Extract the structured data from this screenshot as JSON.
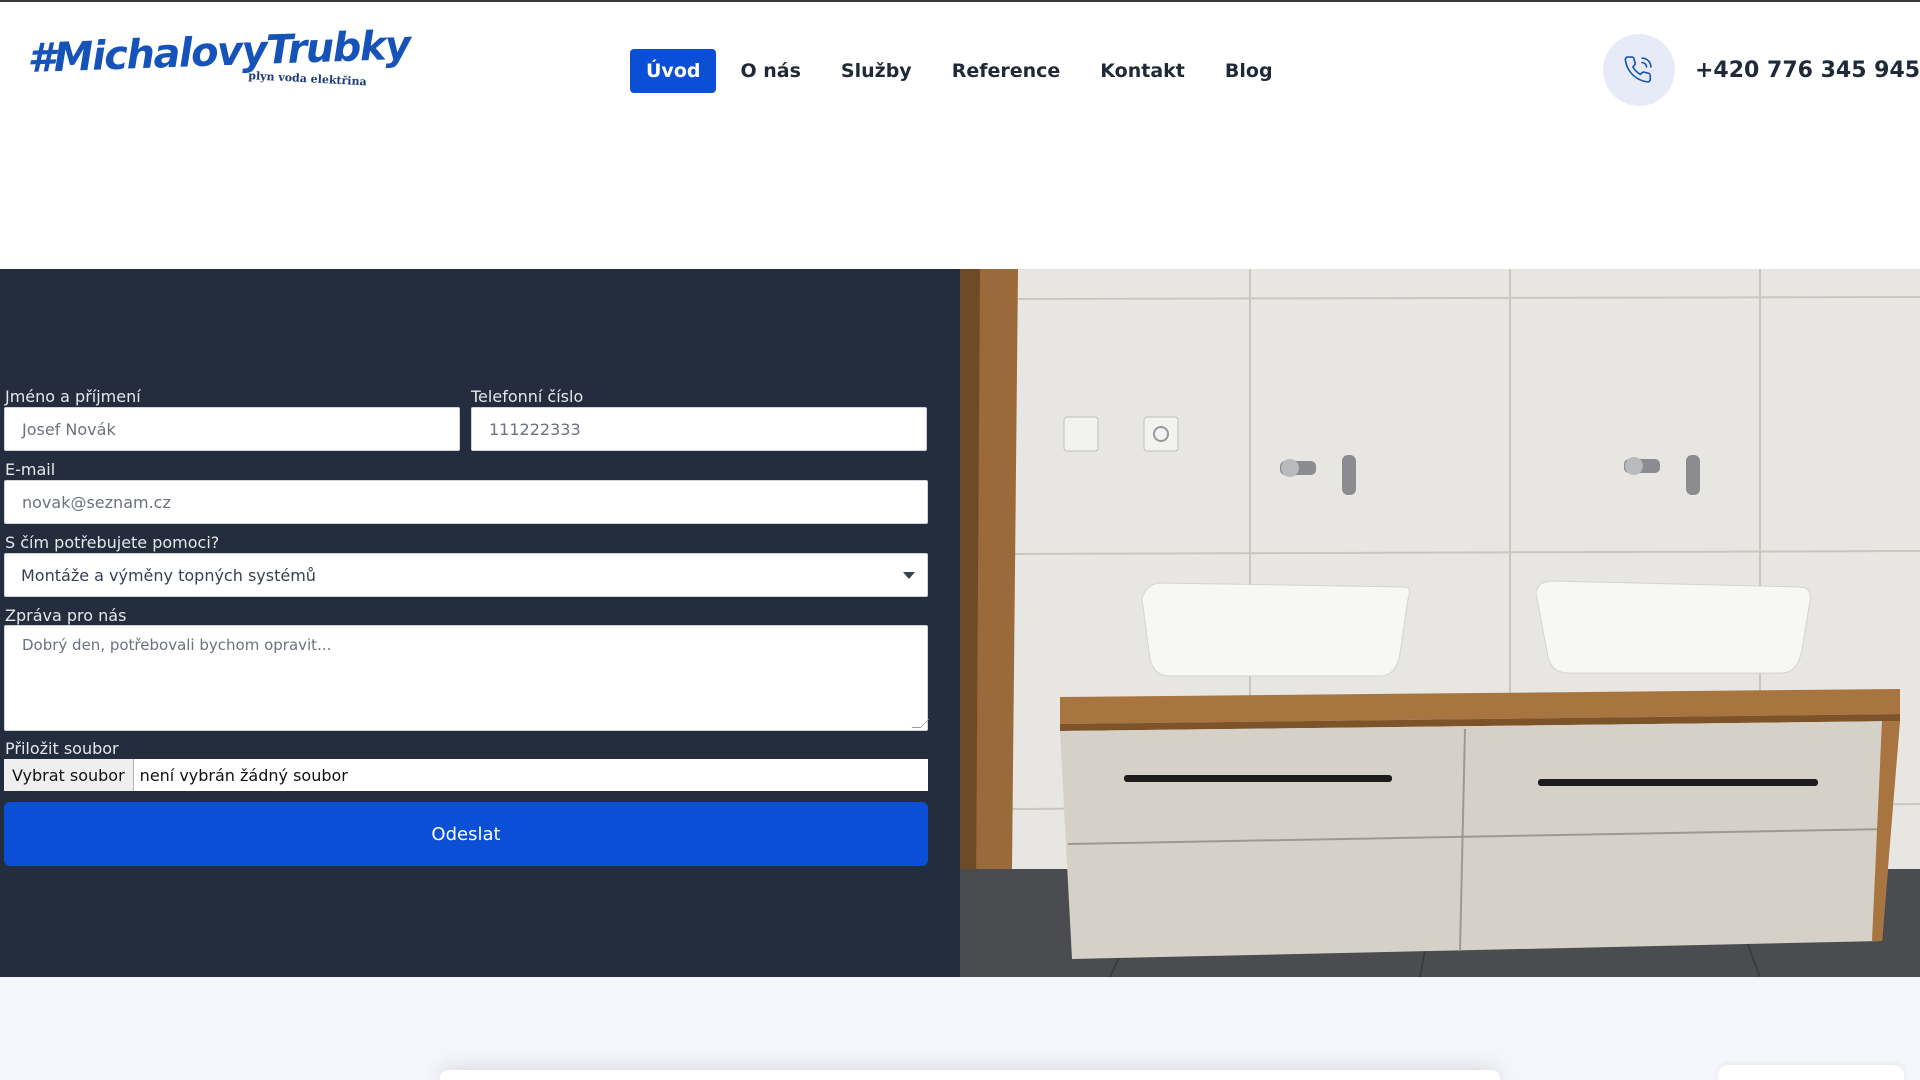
{
  "logo": {
    "text": "#MichalovyTrubky",
    "tagline": "plyn voda elektřina"
  },
  "nav": {
    "items": [
      {
        "label": "Úvod",
        "active": true
      },
      {
        "label": "O nás",
        "active": false
      },
      {
        "label": "Služby",
        "active": false
      },
      {
        "label": "Reference",
        "active": false
      },
      {
        "label": "Kontakt",
        "active": false
      },
      {
        "label": "Blog",
        "active": false
      }
    ]
  },
  "contact": {
    "phone": "+420 776 345 945",
    "icon": "phone-icon"
  },
  "form": {
    "name": {
      "label": "Jméno a příjmení",
      "placeholder": "Josef Novák"
    },
    "phone": {
      "label": "Telefonní číslo",
      "placeholder": "111222333"
    },
    "email": {
      "label": "E-mail",
      "placeholder": "novak@seznam.cz"
    },
    "help": {
      "label": "S čím potřebujete pomoci?",
      "selected": "Montáže a výměny topných systémů"
    },
    "message": {
      "label": "Zpráva pro nás",
      "placeholder": "Dobrý den, potřebovali bychom opravit..."
    },
    "file": {
      "label": "Přiložit soubor",
      "button": "Vybrat soubor",
      "status": "není vybrán žádný soubor"
    },
    "submit": "Odeslat"
  },
  "colors": {
    "brand": "#0b4fd6",
    "panel": "#232d3e",
    "logo": "#1553b8"
  }
}
